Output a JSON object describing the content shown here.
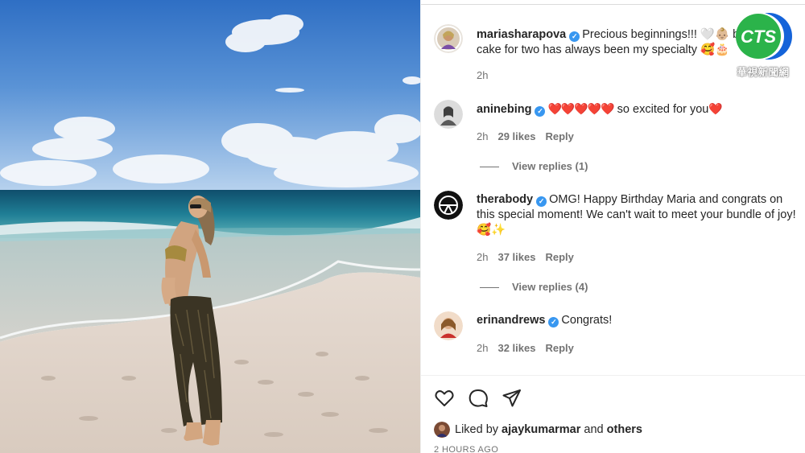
{
  "post": {
    "author": "mariasharapova",
    "caption": "Precious beginnings!!! 🤍👶🏼 birthday cake for two has always been my specialty 🥰🎂",
    "time": "2h"
  },
  "comments": [
    {
      "username": "aninebing",
      "text_before": "",
      "hearts": "❤️❤️❤️❤️❤️",
      "text": " so excited for you",
      "trailing_heart": "❤️",
      "time": "2h",
      "likes": "29 likes",
      "reply": "Reply",
      "view_replies": "View replies (1)"
    },
    {
      "username": "therabody",
      "text": "OMG! Happy Birthday Maria and congrats on this special moment! We can't wait to meet your bundle of joy! 🥰✨",
      "time": "2h",
      "likes": "37 likes",
      "reply": "Reply",
      "view_replies": "View replies (4)"
    },
    {
      "username": "erinandrews",
      "text": "Congrats!",
      "time": "2h",
      "likes": "32 likes",
      "reply": "Reply"
    }
  ],
  "liked_by": {
    "prefix": "Liked by",
    "user": "ajaykumarmar",
    "joiner": "and",
    "others": "others"
  },
  "timestamp": "2 HOURS AGO",
  "watermark": {
    "logo_text": "CTS",
    "caption": "華視新聞網"
  },
  "icons": [
    "heart-icon",
    "comment-icon",
    "share-icon",
    "verified-icon"
  ],
  "colors": {
    "verified": "#3897f0",
    "heart": "#e0202a",
    "logo_green": "#2bb34a",
    "logo_blue": "#1463d9"
  }
}
